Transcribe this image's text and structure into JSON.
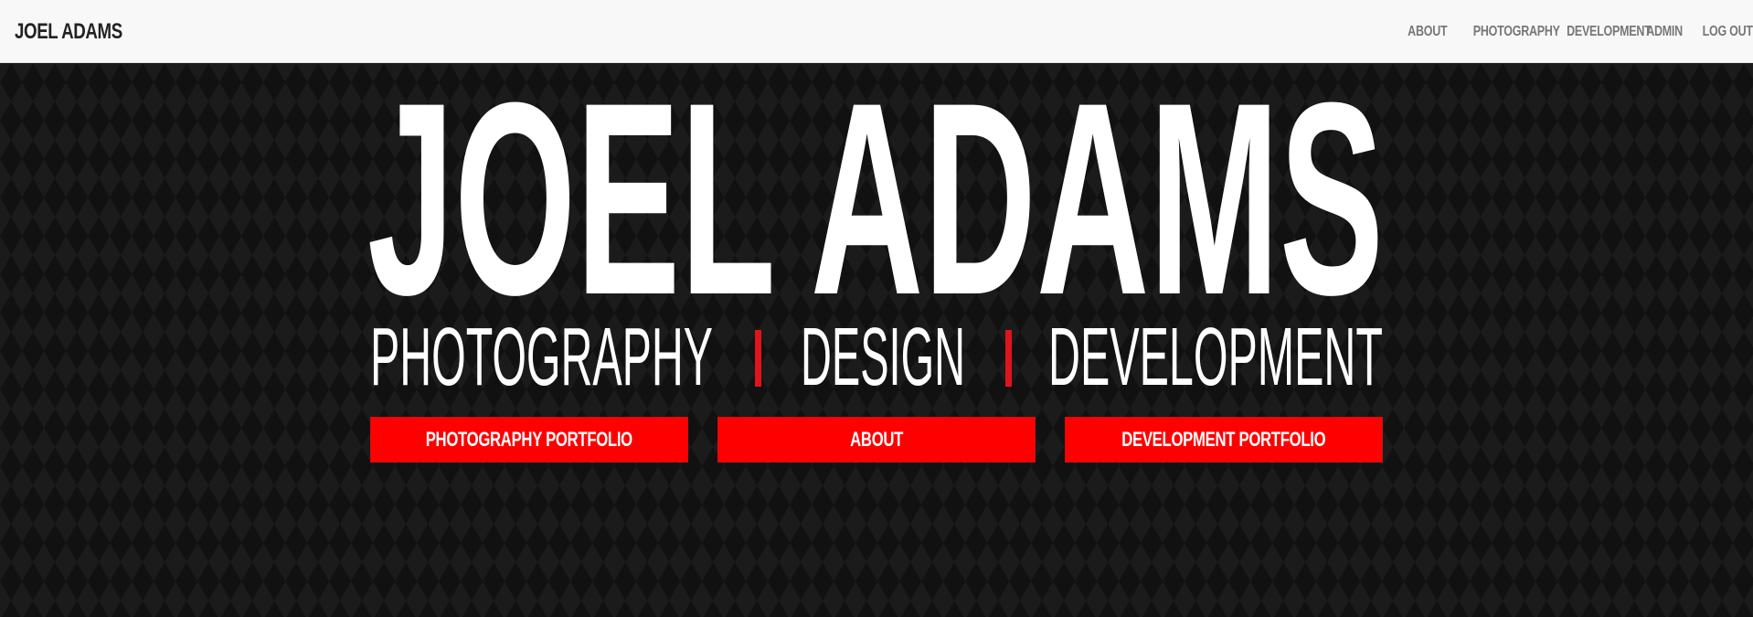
{
  "navbar": {
    "brand": "JOEL ADAMS",
    "links": [
      "ABOUT",
      "PHOTOGRAPHY",
      "DEVELOPMENT",
      "ADMIN",
      "LOG OUT"
    ]
  },
  "hero": {
    "title": "JOEL ADAMS",
    "tagline": {
      "words": [
        "PHOTOGRAPHY",
        "DESIGN",
        "DEVELOPMENT"
      ],
      "separator": "|"
    },
    "buttons": [
      "PHOTOGRAPHY PORTFOLIO",
      "ABOUT",
      "DEVELOPMENT PORTFOLIO"
    ]
  },
  "colors": {
    "accent": "#ff0000",
    "separator": "#e0141b",
    "hero_background": "#151515",
    "navbar_background": "#f8f8f9",
    "hero_text": "#ffffff"
  }
}
